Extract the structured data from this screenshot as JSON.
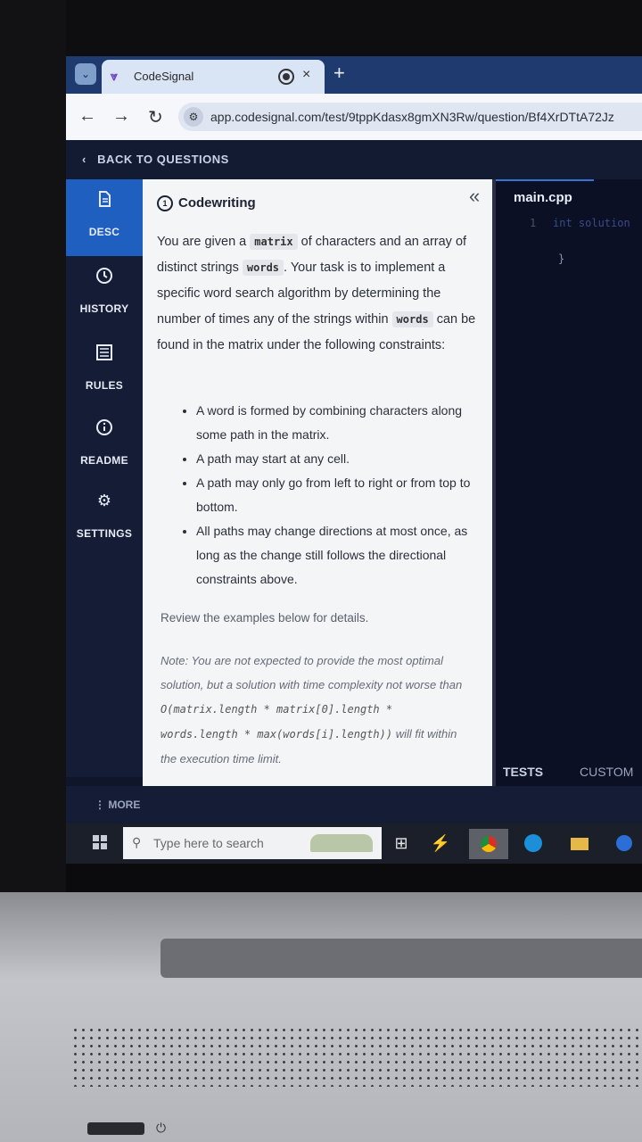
{
  "browser": {
    "tab_title": "CodeSignal",
    "tab_close": "×",
    "tab_new": "+",
    "url": "app.codesignal.com/test/9tppKdasx8gmXN3Rw/question/Bf4XrDTtA72Jz"
  },
  "app": {
    "back_label": "BACK TO QUESTIONS",
    "sidebar": [
      {
        "label": "DESC",
        "icon": "document-icon",
        "active": true
      },
      {
        "label": "HISTORY",
        "icon": "clock-icon"
      },
      {
        "label": "RULES",
        "icon": "list-icon"
      },
      {
        "label": "README",
        "icon": "info-icon"
      },
      {
        "label": "SETTINGS",
        "icon": "gear-icon"
      }
    ],
    "more_label": "⋮ MORE"
  },
  "desc": {
    "heading": "Codewriting",
    "heading_num": "1",
    "p1_a": "You are given a ",
    "p1_code1": "matrix",
    "p1_b": " of characters and an array of distinct strings ",
    "p1_code2": "words",
    "p1_c": ". Your task is to implement a specific word search algorithm by determining the number of times any of the strings within ",
    "p1_code3": "words",
    "p1_d": " can be found in the matrix under the following constraints:",
    "rules": [
      "A word is formed by combining characters along some path in the matrix.",
      "A path may start at any cell.",
      "A path may only go from left to right or from top to bottom.",
      "All paths may change directions at most once, as long as the change still follows the directional constraints above."
    ],
    "review": "Review the examples below for details.",
    "note_a": "Note: You are not expected to provide the most optimal solution, but a solution with time complexity not worse than ",
    "note_code": "O(matrix.length * matrix[0].length * words.length * max(words[i].length))",
    "note_b": " will fit within the execution time limit."
  },
  "editor": {
    "file": "main.cpp",
    "lines": [
      {
        "num": "1",
        "text": "int solution"
      },
      {
        "num": "",
        "text": "}"
      },
      {
        "num": "",
        "text": ""
      }
    ],
    "tabs": [
      "TESTS",
      "CUSTOM"
    ]
  },
  "taskbar": {
    "search_placeholder": "Type here to search"
  }
}
